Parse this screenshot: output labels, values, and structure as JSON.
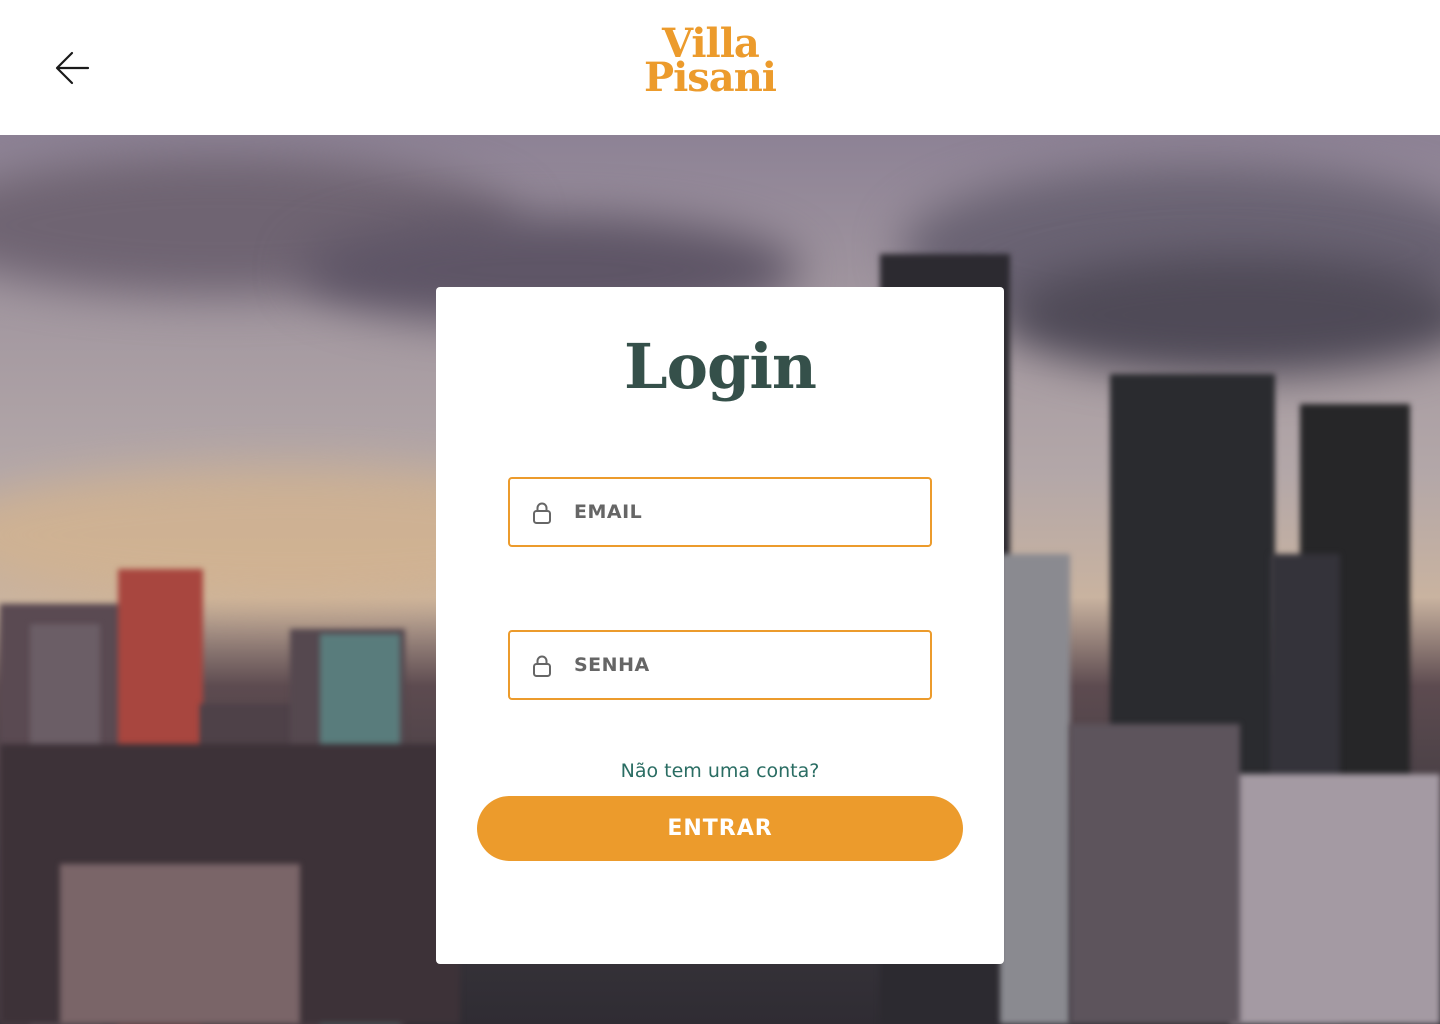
{
  "header": {
    "back_icon": "arrow-left-icon",
    "logo_line1": "Villa",
    "logo_line2": "Pisani"
  },
  "login": {
    "title": "Login",
    "email_placeholder": "EMAIL",
    "email_value": "",
    "email_icon": "lock-icon",
    "password_placeholder": "SENHA",
    "password_value": "",
    "password_icon": "lock-icon",
    "signup_link": "Não tem uma conta?",
    "submit_label": "ENTRAR"
  },
  "colors": {
    "brand_orange": "#ec9b2c",
    "title_green": "#35504a",
    "link_teal": "#2a6d63",
    "placeholder_gray": "#666666"
  }
}
